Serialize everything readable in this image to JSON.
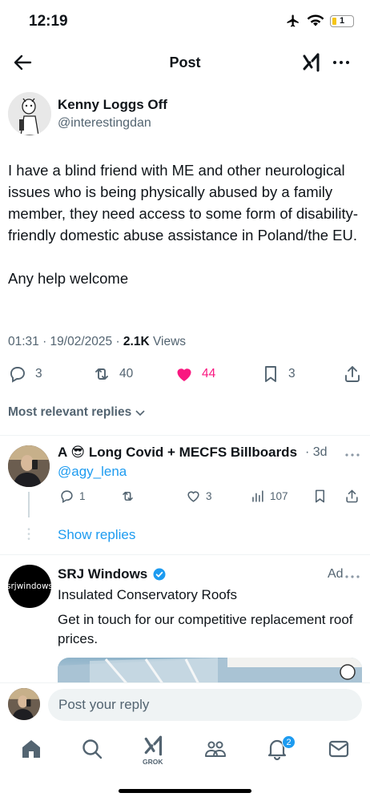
{
  "status_bar": {
    "time": "12:19",
    "battery": "1"
  },
  "header": {
    "title": "Post"
  },
  "post": {
    "author_name": "Kenny Loggs Off",
    "author_handle": "@interestingdan",
    "text": "I have a blind friend with ME and other neurological issues who is being physically abused by a family member, they need access to some form of disability-friendly domestic abuse assistance in Poland/the EU.\n\nAny help welcome",
    "timestamp": "01:31 · 19/02/2025 · ",
    "views_count": "2.1K",
    "views_label": " Views",
    "replies": "3",
    "reposts": "40",
    "likes": "44",
    "bookmarks": "3"
  },
  "sort": {
    "label": "Most relevant replies"
  },
  "reply": {
    "name": "A 😎 Long Covid + MECFS Billboards",
    "time": "· 3d",
    "handle": "@agy_lena",
    "replies": "1",
    "likes": "3",
    "views": "107",
    "show_replies": "Show replies"
  },
  "ad": {
    "avatar_text": "srjwindows",
    "name": "SRJ Windows",
    "label": "Ad",
    "headline": "Insulated Conservatory Roofs",
    "body": "Get in touch for our competitive replacement roof prices."
  },
  "compose": {
    "placeholder": "Post your reply"
  },
  "tabbar": {
    "grok_label": "GROK",
    "notifications_badge": "2"
  },
  "colors": {
    "accent": "#1d9bf0",
    "like": "#f91880",
    "muted": "#536471"
  }
}
